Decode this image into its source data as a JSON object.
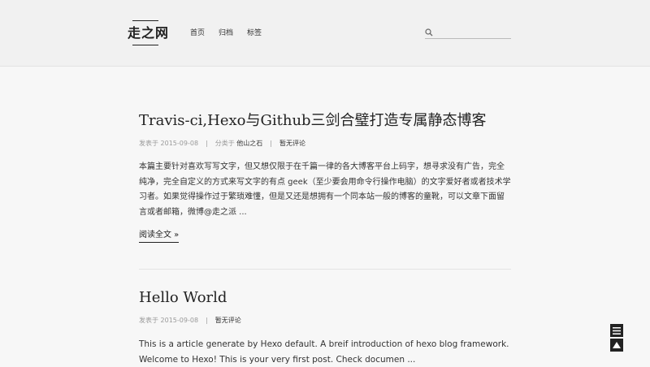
{
  "header": {
    "logo": "走之网",
    "nav": [
      "首页",
      "归档",
      "标签"
    ],
    "search": {
      "placeholder": "",
      "value": ""
    }
  },
  "posts": [
    {
      "title": "Travis-ci,Hexo与Github三剑合璧打造专属静态博客",
      "meta": {
        "date_label": "发表于 2015-09-08",
        "category_prefix": "分类于",
        "category": "他山之石",
        "comments": "暂无评论"
      },
      "excerpt": "本篇主要针对喜欢写写文字，但又想仅限于在千篇一律的各大博客平台上码字，想寻求没有广告，完全纯净，完全自定义的方式来写文字的有点 geek（至少要会用命令行操作电脑）的文字爱好者或者技术学习者。如果觉得操作过于繁琐难懂，但是又还是想拥有一个同本站一般的博客的童靴，可以文章下面留言或者邮箱，微博@走之派 ...",
      "read_more": "阅读全文 »"
    },
    {
      "title": "Hello World",
      "meta": {
        "date_label": "发表于 2015-09-08",
        "comments": "暂无评论"
      },
      "excerpt": "This is a article generate by Hexo default. A breif introduction of hexo blog framework. Welcome to Hexo! This is your very first post. Check documen ..."
    }
  ],
  "icons": {
    "search": "search-icon",
    "menu": "menu-icon",
    "back_to_top": "arrow-up-icon"
  }
}
